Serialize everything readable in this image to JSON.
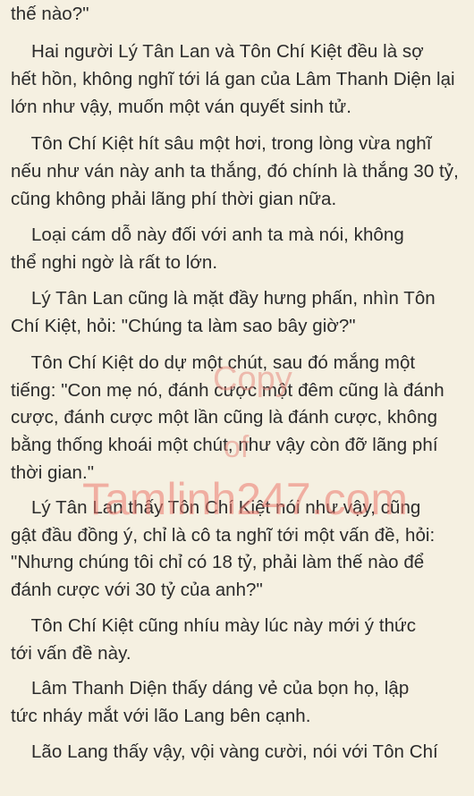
{
  "lines": [
    "thế nào?\"",
    "    Hai người Lý Tân Lan và Tôn Chí Kiệt đều là sợ",
    "hết hồn, không nghĩ tới lá gan của Lâm Thanh Diện lại",
    "lớn như vậy, muốn một ván quyết sinh tử.",
    "    Tôn Chí Kiệt hít sâu một hơi, trong lòng vừa nghĩ",
    "nếu như ván này anh ta thắng, đó chính là thắng 30 tỷ,",
    "cũng không phải lãng phí thời gian nữa.",
    "    Loại cám dỗ này đối với anh ta mà nói, không",
    "thể nghi ngờ là rất to lớn.",
    "    Lý Tân Lan cũng là mặt đầy hưng phấn, nhìn Tôn",
    "Chí Kiệt, hỏi: \"Chúng ta làm sao bây giờ?\"",
    "    Tôn Chí Kiệt do dự một chút, sau đó mắng một",
    "tiếng: \"Con mẹ nó, đánh cược một đêm cũng là đánh",
    "cược, đánh cược một lần cũng là đánh cược, không",
    "bằng thống khoái một chút, như vậy còn đỡ lãng phí",
    "thời gian.\"",
    "    Lý Tân Lan thấy Tôn Chí Kiệt nói như vậy, cũng",
    "gật đầu đồng ý, chỉ là cô ta nghĩ tới một vấn đề, hỏi:",
    "\"Nhưng chúng tôi chỉ có 18 tỷ, phải làm thế nào để",
    "đánh cược với 30 tỷ của anh?\"",
    "    Tôn Chí Kiệt cũng nhíu mày lúc này mới ý thức",
    "tới vấn đề này.",
    "    Lâm Thanh Diện thấy dáng vẻ của bọn họ, lập",
    "tức nháy mắt với lão Lang bên cạnh.",
    "    Lão Lang thấy vậy, vội vàng cười, nói với Tôn Chí"
  ],
  "watermark": {
    "copy": "Copy",
    "of": "of",
    "site": "Tamlinh247.com"
  }
}
